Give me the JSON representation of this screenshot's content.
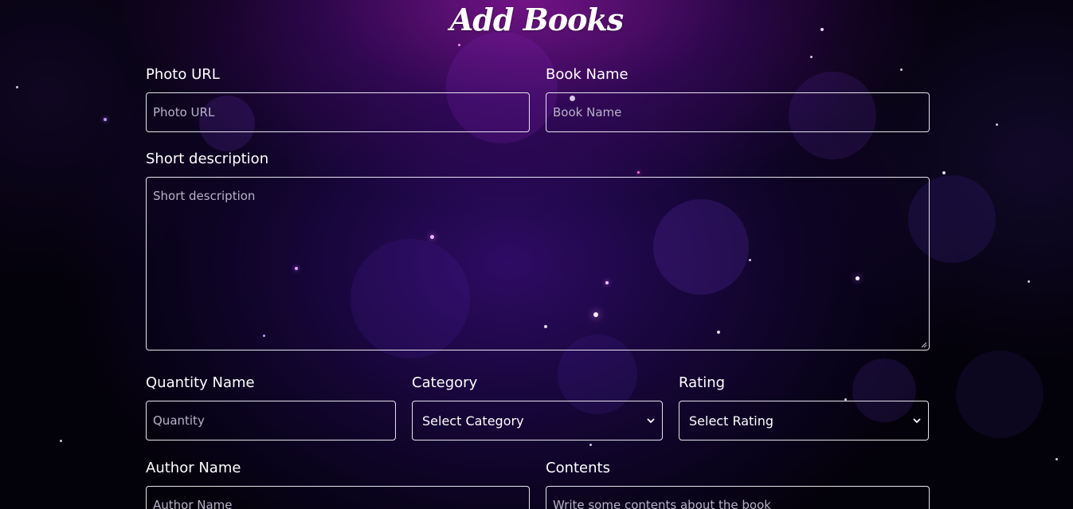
{
  "page": {
    "title": "Add Books"
  },
  "form": {
    "photo_url": {
      "label": "Photo URL",
      "placeholder": "Photo URL"
    },
    "book_name": {
      "label": "Book Name",
      "placeholder": "Book Name"
    },
    "short_description": {
      "label": "Short description",
      "placeholder": "Short description"
    },
    "quantity": {
      "label": "Quantity Name",
      "placeholder": "Quantity"
    },
    "category": {
      "label": "Category",
      "selected": "Select Category"
    },
    "rating": {
      "label": "Rating",
      "selected": "Select Rating"
    },
    "author_name": {
      "label": "Author Name",
      "placeholder": "Author Name"
    },
    "contents": {
      "label": "Contents",
      "placeholder": "Write some contents about the book"
    }
  },
  "theme": {
    "background": "#03010a",
    "accent_top": "#78148c",
    "accent_mid": "#3c0f82",
    "field_border": "#e8e2f0",
    "placeholder": "#b9b2c8"
  },
  "icons": {
    "select_arrow": "chevron-down-icon",
    "textarea_resize": "resize-handle-icon"
  }
}
